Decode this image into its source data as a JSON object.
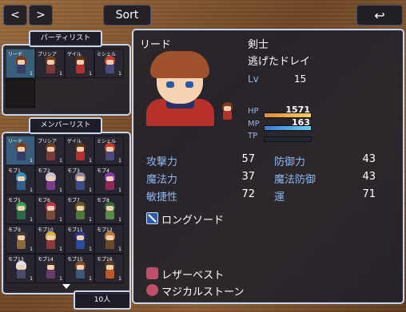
{
  "nav": {
    "prev_icon": "chevron-left-icon",
    "prev_glyph": "<",
    "next_icon": "chevron-right-icon",
    "next_glyph": ">",
    "sort_label": "Sort",
    "back_icon": "return-arrow-icon",
    "back_glyph": "↩"
  },
  "party_title": "パーティリスト",
  "member_title": "メンバーリスト",
  "count_label": "10人",
  "party": [
    {
      "name": "リード",
      "lv": "1",
      "hair": "#7a3b1c",
      "body": "#3a3a66",
      "sel": true
    },
    {
      "name": "プリシア",
      "lv": "1",
      "hair": "#6b3e1f",
      "body": "#7a3a3a"
    },
    {
      "name": "ゲイル",
      "lv": "1",
      "hair": "#5a3318",
      "body": "#b82e2e"
    },
    {
      "name": "ミシェル",
      "lv": "1",
      "hair": "#c73a2a",
      "body": "#4a4a7a"
    }
  ],
  "members": [
    {
      "name": "リード",
      "lv": "1",
      "hair": "#7a3b1c",
      "body": "#3a3a66",
      "sel": true
    },
    {
      "name": "プリシア",
      "lv": "1",
      "hair": "#6b3e1f",
      "body": "#7a3a3a"
    },
    {
      "name": "ゲイル",
      "lv": "1",
      "hair": "#5a3318",
      "body": "#b82e2e"
    },
    {
      "name": "ミシェル",
      "lv": "1",
      "hair": "#c73a2a",
      "body": "#4a4a7a"
    },
    {
      "name": "モブ1",
      "lv": "1",
      "hair": "#2e8fb8",
      "body": "#2f5f8f"
    },
    {
      "name": "モブ2",
      "lv": "1",
      "hair": "#c0c4cc",
      "body": "#7a3a8a"
    },
    {
      "name": "モブ3",
      "lv": "1",
      "hair": "#8a8a9a",
      "body": "#3a4a8a"
    },
    {
      "name": "モブ4",
      "lv": "1",
      "hair": "#8a3aa8",
      "body": "#8a2a5a"
    },
    {
      "name": "モブ5",
      "lv": "1",
      "hair": "#3a9a5a",
      "body": "#2a6a4a"
    },
    {
      "name": "モブ6",
      "lv": "1",
      "hair": "#b83a4a",
      "body": "#7a4a3a"
    },
    {
      "name": "モブ7",
      "lv": "1",
      "hair": "#6a5a2a",
      "body": "#4a7a3a"
    },
    {
      "name": "モブ8",
      "lv": "1",
      "hair": "#3a6a3a",
      "body": "#5a8a4a"
    },
    {
      "name": "モブ9",
      "lv": "1",
      "hair": "#4a3a2a",
      "body": "#8a6a3a"
    },
    {
      "name": "モブ10",
      "lv": "1",
      "hair": "#d8b048",
      "body": "#8a3a3a"
    },
    {
      "name": "モブ11",
      "lv": "1",
      "hair": "#2a3a8a",
      "body": "#2a4aa8"
    },
    {
      "name": "モブ12",
      "lv": "1",
      "hair": "#b87a3a",
      "body": "#6a4a2a"
    },
    {
      "name": "モブ13",
      "lv": "1",
      "hair": "#e0e0e8",
      "body": "#4a4a6a"
    },
    {
      "name": "モブ14",
      "lv": "1",
      "hair": "#3a2a2a",
      "body": "#6a3a6a"
    },
    {
      "name": "モブ15",
      "lv": "1",
      "hair": "#7a4a2a",
      "body": "#3a5a7a"
    },
    {
      "name": "モブ16",
      "lv": "1",
      "hair": "#5a3a1a",
      "body": "#b85a2a"
    }
  ],
  "status": {
    "name": "リード",
    "class": "剣士",
    "title": "逃げたドレイ",
    "lv_label": "Lv",
    "lv": "15",
    "hp_label": "HP",
    "hp": "1571",
    "hp_fill": 1.0,
    "mp_label": "MP",
    "mp": "163",
    "mp_fill": 1.0,
    "tp_label": "TP",
    "tp_fill": 0.0,
    "params": [
      {
        "label": "攻撃力",
        "value": "57"
      },
      {
        "label": "防御力",
        "value": "43"
      },
      {
        "label": "魔法力",
        "value": "37"
      },
      {
        "label": "魔法防御",
        "value": "43"
      },
      {
        "label": "敏捷性",
        "value": "72"
      },
      {
        "label": "運",
        "value": "71"
      }
    ],
    "weapon": {
      "icon": "sword-icon",
      "name": "ロングソード"
    },
    "armor": [
      {
        "icon": "armor-icon",
        "name": "レザーベスト"
      },
      {
        "icon": "accessory-icon",
        "name": "マジカルストーン"
      }
    ]
  },
  "colors": {
    "hp_a": "#e08a3c",
    "hp_b": "#f2d060",
    "mp_a": "#3c7ad8",
    "mp_b": "#6ad0f2",
    "tp": "#3aa04a",
    "label": "#8fb8f0"
  }
}
